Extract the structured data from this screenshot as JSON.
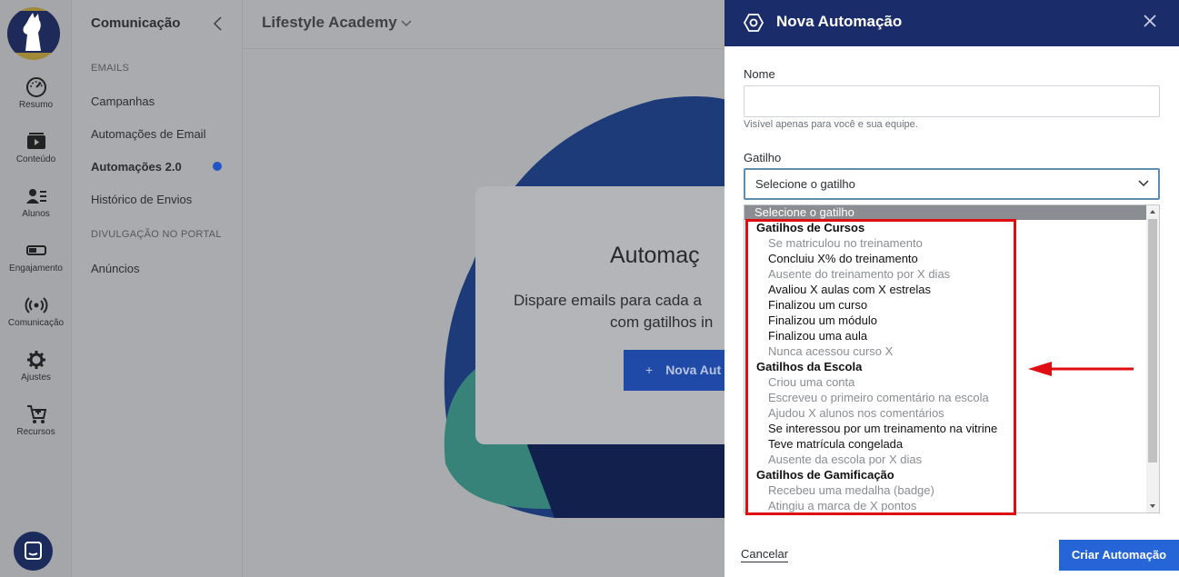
{
  "rail": {
    "items": [
      {
        "label": "Resumo",
        "icon": "gauge-icon"
      },
      {
        "label": "Conteúdo",
        "icon": "video-icon"
      },
      {
        "label": "Alunos",
        "icon": "users-icon"
      },
      {
        "label": "Engajamento",
        "icon": "toggle-icon"
      },
      {
        "label": "Comunicação",
        "icon": "broadcast-icon"
      },
      {
        "label": "Ajustes",
        "icon": "gear-icon"
      },
      {
        "label": "Recursos",
        "icon": "cart-icon"
      }
    ]
  },
  "subnav": {
    "title": "Comunicação",
    "section_emails": "EMAILS",
    "links": [
      "Campanhas",
      "Automações de Email",
      "Automações 2.0",
      "Histórico de Envios"
    ],
    "section_portal": "DIVULGAÇÃO NO PORTAL",
    "portal_links": [
      "Anúncios"
    ]
  },
  "main": {
    "title": "Lifestyle Academy",
    "card_title": "Automaç",
    "card_sub_line1": "Dispare emails para cada a",
    "card_sub_line2": "com gatilhos in",
    "card_button": "Nova Aut"
  },
  "drawer": {
    "title": "Nova Automação",
    "name_label": "Nome",
    "name_value": "",
    "name_hint": "Visível apenas para você e sua equipe.",
    "trigger_label": "Gatilho",
    "trigger_value": "Selecione o gatilho",
    "cancel": "Cancelar",
    "create": "Criar Automação"
  },
  "dropdown": {
    "selected": "Selecione o gatilho",
    "groups": [
      {
        "label": "Gatilhos de Cursos",
        "options": [
          {
            "label": "Se matriculou no treinamento",
            "enabled": false
          },
          {
            "label": "Concluiu X% do treinamento",
            "enabled": true
          },
          {
            "label": "Ausente do treinamento por X dias",
            "enabled": false
          },
          {
            "label": "Avaliou X aulas com X estrelas",
            "enabled": true
          },
          {
            "label": "Finalizou um curso",
            "enabled": true
          },
          {
            "label": "Finalizou um módulo",
            "enabled": true
          },
          {
            "label": "Finalizou uma aula",
            "enabled": true
          },
          {
            "label": "Nunca acessou curso X",
            "enabled": false
          }
        ]
      },
      {
        "label": "Gatilhos da Escola",
        "options": [
          {
            "label": "Criou uma conta",
            "enabled": false
          },
          {
            "label": "Escreveu o primeiro comentário na escola",
            "enabled": false
          },
          {
            "label": "Ajudou X alunos nos comentários",
            "enabled": false
          },
          {
            "label": "Se interessou por um treinamento na vitrine",
            "enabled": true
          },
          {
            "label": "Teve matrícula congelada",
            "enabled": true
          },
          {
            "label": "Ausente da escola por X dias",
            "enabled": false
          }
        ]
      },
      {
        "label": "Gatilhos de Gamificação",
        "options": [
          {
            "label": "Recebeu uma medalha (badge)",
            "enabled": false
          },
          {
            "label": "Atingiu a marca de X pontos",
            "enabled": false
          }
        ]
      }
    ]
  },
  "colors": {
    "drawer_header": "#1b2c6b",
    "primary_button": "#2565d8",
    "highlight": "#e00d12"
  }
}
